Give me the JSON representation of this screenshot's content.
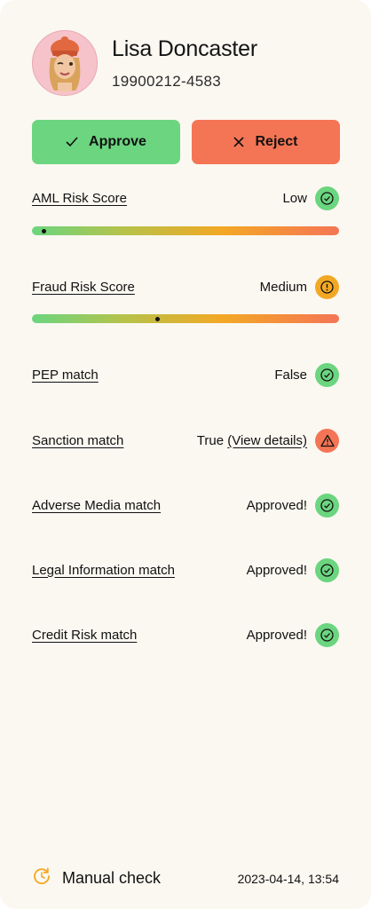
{
  "profile": {
    "name": "Lisa Doncaster",
    "personal_id": "19900212-4583",
    "avatar_icon": "memoji-avatar"
  },
  "actions": {
    "approve_label": "Approve",
    "reject_label": "Reject"
  },
  "checks": {
    "aml": {
      "label": "AML Risk Score",
      "value": "Low",
      "status_icon": "check-circle-icon",
      "risk_level": 0.04
    },
    "fraud": {
      "label": "Fraud Risk Score",
      "value": "Medium",
      "status_icon": "exclamation-circle-icon",
      "risk_level": 0.41
    },
    "pep": {
      "label": "PEP match",
      "value": "False",
      "status_icon": "check-circle-icon"
    },
    "sanction": {
      "label": "Sanction match",
      "value": "True",
      "link": "(View details)",
      "status_icon": "warning-triangle-icon"
    },
    "adverse_media": {
      "label": "Adverse Media match",
      "value": "Approved!",
      "status_icon": "check-circle-icon"
    },
    "legal_info": {
      "label": "Legal Information match",
      "value": "Approved!",
      "status_icon": "check-circle-icon"
    },
    "credit_risk": {
      "label": "Credit Risk match",
      "value": "Approved!",
      "status_icon": "check-circle-icon"
    }
  },
  "footer": {
    "method_icon": "manual-check-clock-icon",
    "method_label": "Manual check",
    "timestamp": "2023-04-14, 13:54"
  },
  "colors": {
    "background": "#fbf8f1",
    "approve": "#6bd57f",
    "reject": "#f47555",
    "warning": "#f3a825"
  }
}
